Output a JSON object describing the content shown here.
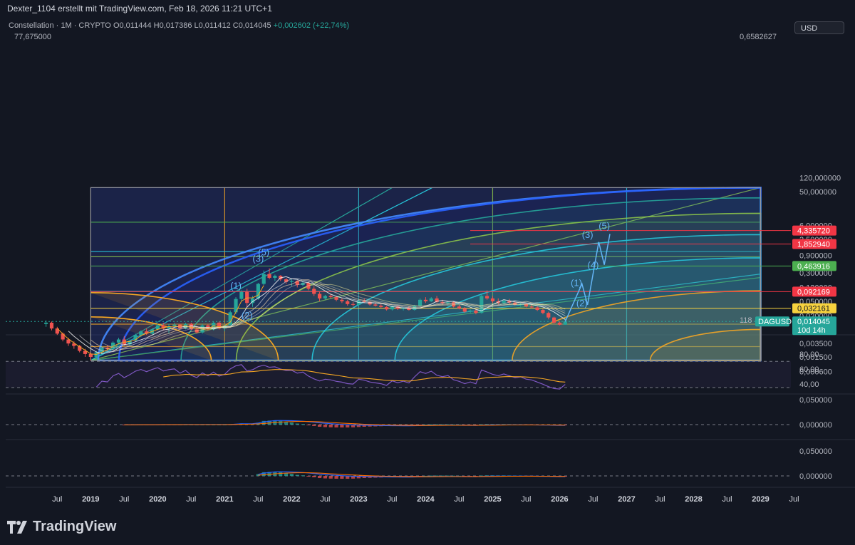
{
  "header": {
    "caption": "Dexter_1104 erstellt mit TradingView.com, Feb 18, 2026 11:21 UTC+1"
  },
  "legend": {
    "name": "Constellation · 1M · CRYPTO",
    "open": "O0,011444",
    "high": "H0,017386",
    "low": "L0,011412",
    "close": "C0,014045",
    "change": "+0,002602 (+22,74%)"
  },
  "currency_button": "USD",
  "corner_labels": {
    "top_left": "77,675000",
    "top_right": "0,6582627",
    "bottom_box": "118"
  },
  "brand": "TradingView",
  "colors": {
    "bg": "#131722",
    "up": "#26a69a",
    "down": "#ef5350"
  },
  "chart_data": {
    "type": "candlestick",
    "y_scale": "log",
    "ylim": [
      0.0004,
      130
    ],
    "price_ticks": [
      "120,000000",
      "50,000000",
      "6,000000",
      "2,500000",
      "0,900000",
      "0,300000",
      "0,120000",
      "0,050000",
      "0,020000",
      "0,003500",
      "0,001500",
      "0,000600"
    ],
    "price_tick_values": [
      120,
      50,
      6,
      2.5,
      0.9,
      0.3,
      0.12,
      0.05,
      0.02,
      0.0035,
      0.0015,
      0.0006
    ],
    "x_ticks": [
      "Jul",
      "2019",
      "Jul",
      "2020",
      "Jul",
      "2021",
      "Jul",
      "2022",
      "Jul",
      "2023",
      "Jul",
      "2024",
      "Jul",
      "2025",
      "Jul",
      "2026",
      "Jul",
      "2027",
      "Jul",
      "2028",
      "Jul",
      "2029",
      "Jul"
    ],
    "x_tick_values": [
      "2018-07",
      "2019-01",
      "2019-07",
      "2020-01",
      "2020-07",
      "2021-01",
      "2021-07",
      "2022-01",
      "2022-07",
      "2023-01",
      "2023-07",
      "2024-01",
      "2024-07",
      "2025-01",
      "2025-07",
      "2026-01",
      "2026-07",
      "2027-01",
      "2027-07",
      "2028-01",
      "2028-07",
      "2029-01",
      "2029-07"
    ],
    "bold_x_ticks": [
      "2019",
      "2020",
      "2021",
      "2022",
      "2023",
      "2024",
      "2025",
      "2026",
      "2027",
      "2028",
      "2029"
    ],
    "candles": [
      [
        "2018-05",
        0.012,
        0.015,
        0.01,
        0.013
      ],
      [
        "2018-06",
        0.013,
        0.014,
        0.008,
        0.009
      ],
      [
        "2018-07",
        0.009,
        0.01,
        0.006,
        0.0065
      ],
      [
        "2018-08",
        0.0065,
        0.007,
        0.004,
        0.0045
      ],
      [
        "2018-09",
        0.0045,
        0.005,
        0.003,
        0.0035
      ],
      [
        "2018-10",
        0.0035,
        0.004,
        0.0025,
        0.003
      ],
      [
        "2018-11",
        0.003,
        0.0032,
        0.002,
        0.0022
      ],
      [
        "2018-12",
        0.0022,
        0.0025,
        0.0015,
        0.0018
      ],
      [
        "2019-01",
        0.0018,
        0.002,
        0.0012,
        0.0015
      ],
      [
        "2019-02",
        0.0015,
        0.0022,
        0.0013,
        0.002
      ],
      [
        "2019-03",
        0.002,
        0.003,
        0.0018,
        0.0027
      ],
      [
        "2019-04",
        0.0027,
        0.0032,
        0.0022,
        0.0025
      ],
      [
        "2019-05",
        0.0025,
        0.004,
        0.0023,
        0.0037
      ],
      [
        "2019-06",
        0.0037,
        0.005,
        0.0033,
        0.0045
      ],
      [
        "2019-07",
        0.0045,
        0.0055,
        0.003,
        0.0033
      ],
      [
        "2019-08",
        0.0033,
        0.0045,
        0.003,
        0.0042
      ],
      [
        "2019-09",
        0.0042,
        0.0065,
        0.004,
        0.006
      ],
      [
        "2019-10",
        0.006,
        0.008,
        0.0052,
        0.0075
      ],
      [
        "2019-11",
        0.0075,
        0.009,
        0.006,
        0.0065
      ],
      [
        "2019-12",
        0.0065,
        0.009,
        0.006,
        0.0085
      ],
      [
        "2020-01",
        0.0085,
        0.012,
        0.008,
        0.011
      ],
      [
        "2020-02",
        0.011,
        0.013,
        0.008,
        0.009
      ],
      [
        "2020-03",
        0.009,
        0.012,
        0.0065,
        0.0105
      ],
      [
        "2020-04",
        0.0105,
        0.013,
        0.0095,
        0.0115
      ],
      [
        "2020-05",
        0.0115,
        0.012,
        0.0085,
        0.009
      ],
      [
        "2020-06",
        0.009,
        0.013,
        0.0085,
        0.012
      ],
      [
        "2020-07",
        0.012,
        0.013,
        0.008,
        0.0085
      ],
      [
        "2020-08",
        0.0085,
        0.01,
        0.0065,
        0.007
      ],
      [
        "2020-09",
        0.007,
        0.012,
        0.0065,
        0.011
      ],
      [
        "2020-10",
        0.011,
        0.012,
        0.008,
        0.0085
      ],
      [
        "2020-11",
        0.0085,
        0.014,
        0.008,
        0.013
      ],
      [
        "2020-12",
        0.013,
        0.014,
        0.0085,
        0.009
      ],
      [
        "2021-01",
        0.009,
        0.012,
        0.0075,
        0.011
      ],
      [
        "2021-02",
        0.011,
        0.028,
        0.011,
        0.025
      ],
      [
        "2021-03",
        0.025,
        0.065,
        0.022,
        0.058
      ],
      [
        "2021-04",
        0.058,
        0.1,
        0.05,
        0.09
      ],
      [
        "2021-05",
        0.09,
        0.11,
        0.035,
        0.045
      ],
      [
        "2021-06",
        0.045,
        0.07,
        0.035,
        0.06
      ],
      [
        "2021-07",
        0.06,
        0.16,
        0.055,
        0.15
      ],
      [
        "2021-08",
        0.15,
        0.35,
        0.14,
        0.28
      ],
      [
        "2021-09",
        0.28,
        0.4,
        0.2,
        0.22
      ],
      [
        "2021-10",
        0.22,
        0.27,
        0.18,
        0.25
      ],
      [
        "2021-11",
        0.25,
        0.26,
        0.18,
        0.2
      ],
      [
        "2021-12",
        0.2,
        0.22,
        0.15,
        0.17
      ],
      [
        "2022-01",
        0.17,
        0.21,
        0.13,
        0.18
      ],
      [
        "2022-02",
        0.18,
        0.19,
        0.12,
        0.14
      ],
      [
        "2022-03",
        0.14,
        0.18,
        0.13,
        0.16
      ],
      [
        "2022-04",
        0.16,
        0.17,
        0.1,
        0.11
      ],
      [
        "2022-05",
        0.11,
        0.13,
        0.07,
        0.08
      ],
      [
        "2022-06",
        0.08,
        0.09,
        0.05,
        0.06
      ],
      [
        "2022-07",
        0.06,
        0.075,
        0.055,
        0.07
      ],
      [
        "2022-08",
        0.07,
        0.08,
        0.06,
        0.065
      ],
      [
        "2022-09",
        0.065,
        0.07,
        0.05,
        0.055
      ],
      [
        "2022-10",
        0.055,
        0.06,
        0.045,
        0.05
      ],
      [
        "2022-11",
        0.05,
        0.055,
        0.038,
        0.042
      ],
      [
        "2022-12",
        0.042,
        0.048,
        0.036,
        0.04
      ],
      [
        "2023-01",
        0.04,
        0.055,
        0.038,
        0.052
      ],
      [
        "2023-02",
        0.052,
        0.06,
        0.045,
        0.048
      ],
      [
        "2023-03",
        0.048,
        0.05,
        0.038,
        0.041
      ],
      [
        "2023-04",
        0.041,
        0.046,
        0.036,
        0.038
      ],
      [
        "2023-05",
        0.038,
        0.042,
        0.033,
        0.035
      ],
      [
        "2023-06",
        0.035,
        0.037,
        0.028,
        0.03
      ],
      [
        "2023-07",
        0.03,
        0.038,
        0.028,
        0.036
      ],
      [
        "2023-08",
        0.036,
        0.037,
        0.029,
        0.031
      ],
      [
        "2023-09",
        0.031,
        0.034,
        0.028,
        0.033
      ],
      [
        "2023-10",
        0.033,
        0.036,
        0.028,
        0.029
      ],
      [
        "2023-11",
        0.029,
        0.04,
        0.028,
        0.038
      ],
      [
        "2023-12",
        0.038,
        0.06,
        0.036,
        0.055
      ],
      [
        "2024-01",
        0.055,
        0.065,
        0.045,
        0.05
      ],
      [
        "2024-02",
        0.05,
        0.065,
        0.048,
        0.06
      ],
      [
        "2024-03",
        0.06,
        0.07,
        0.045,
        0.048
      ],
      [
        "2024-04",
        0.048,
        0.055,
        0.04,
        0.044
      ],
      [
        "2024-05",
        0.044,
        0.05,
        0.038,
        0.047
      ],
      [
        "2024-06",
        0.047,
        0.049,
        0.034,
        0.036
      ],
      [
        "2024-07",
        0.036,
        0.04,
        0.03,
        0.032
      ],
      [
        "2024-08",
        0.032,
        0.035,
        0.024,
        0.026
      ],
      [
        "2024-09",
        0.026,
        0.03,
        0.024,
        0.028
      ],
      [
        "2024-10",
        0.028,
        0.03,
        0.022,
        0.024
      ],
      [
        "2024-11",
        0.024,
        0.075,
        0.023,
        0.07
      ],
      [
        "2024-12",
        0.07,
        0.1,
        0.055,
        0.06
      ],
      [
        "2025-01",
        0.06,
        0.07,
        0.045,
        0.05
      ],
      [
        "2025-02",
        0.05,
        0.06,
        0.04,
        0.045
      ],
      [
        "2025-03",
        0.045,
        0.055,
        0.04,
        0.052
      ],
      [
        "2025-04",
        0.052,
        0.058,
        0.042,
        0.046
      ],
      [
        "2025-05",
        0.046,
        0.05,
        0.038,
        0.04
      ],
      [
        "2025-06",
        0.04,
        0.045,
        0.036,
        0.042
      ],
      [
        "2025-07",
        0.042,
        0.044,
        0.034,
        0.036
      ],
      [
        "2025-08",
        0.036,
        0.04,
        0.032,
        0.034
      ],
      [
        "2025-09",
        0.034,
        0.036,
        0.027,
        0.029
      ],
      [
        "2025-10",
        0.029,
        0.031,
        0.022,
        0.024
      ],
      [
        "2025-11",
        0.024,
        0.026,
        0.016,
        0.018
      ],
      [
        "2025-12",
        0.018,
        0.019,
        0.012,
        0.013
      ],
      [
        "2026-01",
        0.013,
        0.014,
        0.011,
        0.0114
      ],
      [
        "2026-02",
        0.011444,
        0.017386,
        0.011412,
        0.014045
      ]
    ],
    "price_labels": [
      {
        "value": 4.33572,
        "text": "4,335720",
        "color": "#f23645"
      },
      {
        "value": 1.85294,
        "text": "1,852940",
        "color": "#f23645"
      },
      {
        "value": 0.463916,
        "text": "0,463916",
        "color": "#4caf50"
      },
      {
        "value": 0.092169,
        "text": "0,092169",
        "color": "#f23645"
      },
      {
        "value": 0.032161,
        "text": "0,032161",
        "color": "#f7d23e"
      }
    ],
    "current": {
      "symbol": "DAGUSD",
      "value": 0.014045,
      "text": "0,014045",
      "countdown": "10d 14h"
    },
    "gann_box": {
      "start": "2019-01",
      "end": "2029-01",
      "price_low": 0.0012,
      "price_high": 65
    },
    "wave_labels": [
      {
        "text": "(1)",
        "date": "2021-03",
        "price": 0.11
      },
      {
        "text": "(2)",
        "date": "2021-05",
        "price": 0.017
      },
      {
        "text": "(3)",
        "date": "2021-07",
        "price": 0.6
      },
      {
        "text": "(5)",
        "date": "2021-08",
        "price": 0.9
      },
      {
        "text": "(1)",
        "date": "2026-04",
        "price": 0.13
      },
      {
        "text": "(2)",
        "date": "2026-05",
        "price": 0.036
      },
      {
        "text": "(3)",
        "date": "2026-06",
        "price": 2.7
      },
      {
        "text": "(4)",
        "date": "2026-07",
        "price": 0.4
      },
      {
        "text": "(5)",
        "date": "2026-09",
        "price": 4.8
      }
    ],
    "projection": [
      [
        "2026-02",
        0.014
      ],
      [
        "2026-05",
        0.15
      ],
      [
        "2026-06",
        0.04
      ],
      [
        "2026-08",
        2.1
      ],
      [
        "2026-09",
        0.5
      ],
      [
        "2026-10",
        3.5
      ]
    ],
    "rsi": {
      "ticks": [
        "80,00",
        "60,00",
        "40,00"
      ],
      "tick_values": [
        80,
        60,
        40
      ],
      "band": [
        70,
        30
      ]
    },
    "macd_ticks": [
      "0,050000",
      "0,000000"
    ],
    "macd2_ticks": [
      "0,050000",
      "0,000000"
    ]
  }
}
